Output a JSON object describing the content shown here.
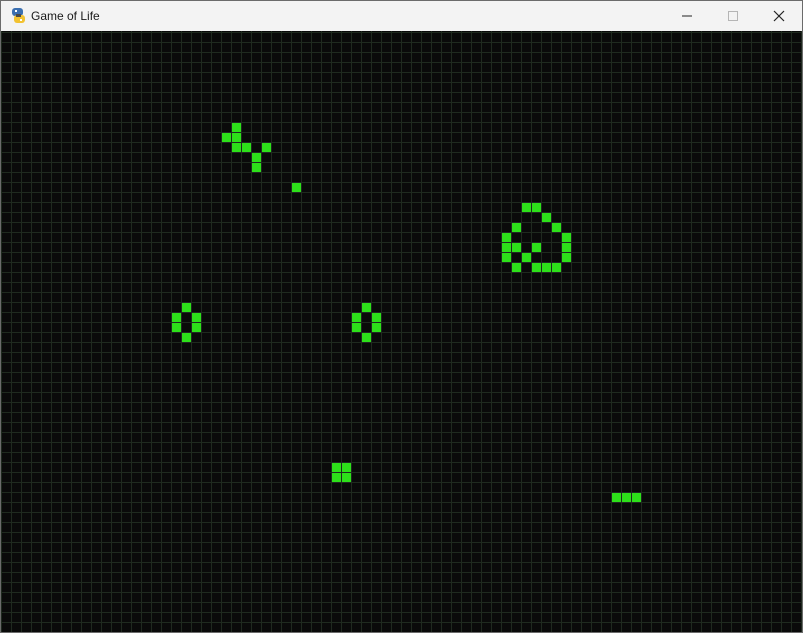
{
  "window": {
    "title": "Game of Life",
    "app_icon": "python-icon",
    "controls": {
      "minimize_icon": "minimize-icon",
      "maximize_icon": "maximize-icon",
      "close_icon": "close-icon"
    }
  },
  "board": {
    "columns": 80,
    "rows": 60,
    "background_color": "#0a0a0a",
    "grid_color": "#1f2a1f",
    "live_cell_color": "#2de01a",
    "live_cells": [
      [
        23,
        9
      ],
      [
        22,
        10
      ],
      [
        23,
        10
      ],
      [
        23,
        11
      ],
      [
        24,
        11
      ],
      [
        26,
        11
      ],
      [
        25,
        12
      ],
      [
        25,
        13
      ],
      [
        29,
        15
      ],
      [
        52,
        17
      ],
      [
        53,
        17
      ],
      [
        54,
        18
      ],
      [
        51,
        19
      ],
      [
        55,
        19
      ],
      [
        50,
        20
      ],
      [
        56,
        20
      ],
      [
        50,
        21
      ],
      [
        51,
        21
      ],
      [
        53,
        21
      ],
      [
        56,
        21
      ],
      [
        50,
        22
      ],
      [
        52,
        22
      ],
      [
        56,
        22
      ],
      [
        51,
        23
      ],
      [
        53,
        23
      ],
      [
        54,
        23
      ],
      [
        55,
        23
      ],
      [
        18,
        27
      ],
      [
        17,
        28
      ],
      [
        19,
        28
      ],
      [
        17,
        29
      ],
      [
        19,
        29
      ],
      [
        18,
        30
      ],
      [
        36,
        27
      ],
      [
        35,
        28
      ],
      [
        37,
        28
      ],
      [
        35,
        29
      ],
      [
        37,
        29
      ],
      [
        36,
        30
      ],
      [
        33,
        43
      ],
      [
        34,
        43
      ],
      [
        33,
        44
      ],
      [
        34,
        44
      ],
      [
        61,
        46
      ],
      [
        62,
        46
      ],
      [
        63,
        46
      ]
    ]
  }
}
